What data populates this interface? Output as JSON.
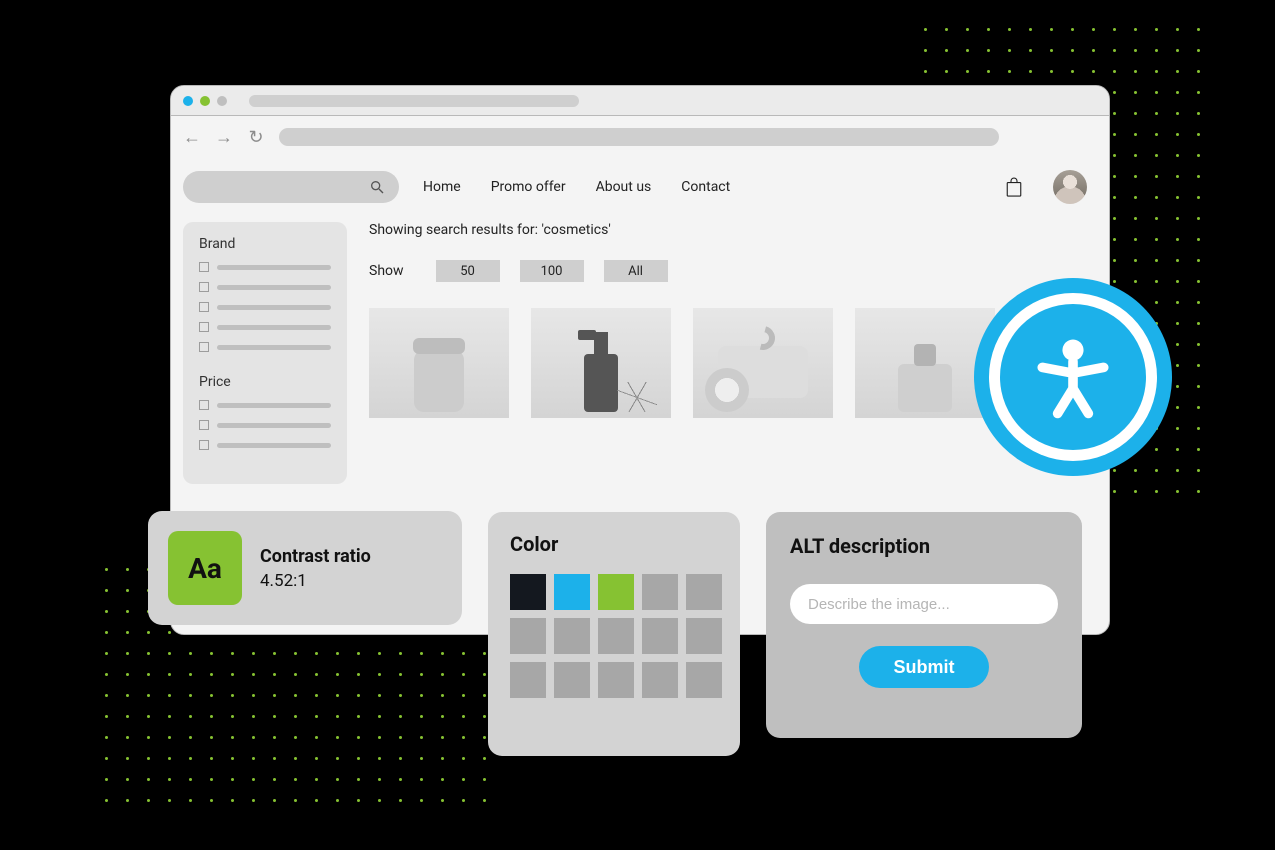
{
  "nav": {
    "home": "Home",
    "promo": "Promo offer",
    "about": "About us",
    "contact": "Contact"
  },
  "filters": {
    "brand_title": "Brand",
    "price_title": "Price"
  },
  "results": {
    "text": "Showing search results for: 'cosmetics'",
    "show_label": "Show",
    "opt_50": "50",
    "opt_100": "100",
    "opt_all": "All"
  },
  "contrast": {
    "symbol": "Aa",
    "title": "Contrast ratio",
    "value": "4.52:1"
  },
  "color": {
    "title": "Color"
  },
  "alt": {
    "title": "ALT description",
    "placeholder": "Describe the image...",
    "submit": "Submit"
  }
}
